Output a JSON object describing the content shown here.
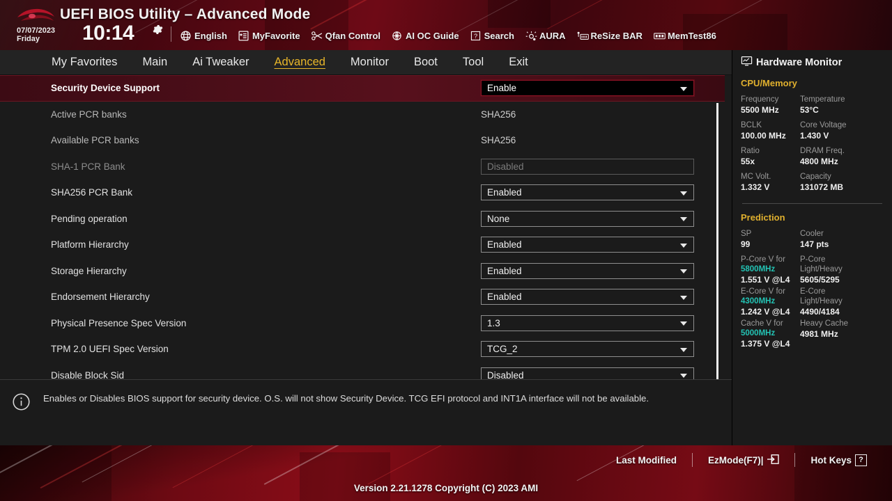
{
  "header": {
    "title": "UEFI BIOS Utility – Advanced Mode",
    "logo_name": "rog-logo",
    "date": "07/07/2023",
    "weekday": "Friday",
    "time": "10:14",
    "gear_icon": "gear-icon",
    "toolbar": [
      {
        "label": "English",
        "icon": "globe-icon"
      },
      {
        "label": "MyFavorite",
        "icon": "star-list-icon"
      },
      {
        "label": "Qfan Control",
        "icon": "fan-icon"
      },
      {
        "label": "AI OC Guide",
        "icon": "ai-brain-icon"
      },
      {
        "label": "Search",
        "icon": "question-box-icon"
      },
      {
        "label": "AURA",
        "icon": "lightbulb-icon"
      },
      {
        "label": "ReSize BAR",
        "icon": "resize-bar-icon"
      },
      {
        "label": "MemTest86",
        "icon": "memory-icon"
      }
    ]
  },
  "menu": {
    "tabs": [
      {
        "label": "My Favorites",
        "active": false
      },
      {
        "label": "Main",
        "active": false
      },
      {
        "label": "Ai Tweaker",
        "active": false
      },
      {
        "label": "Advanced",
        "active": true
      },
      {
        "label": "Monitor",
        "active": false
      },
      {
        "label": "Boot",
        "active": false
      },
      {
        "label": "Tool",
        "active": false
      },
      {
        "label": "Exit",
        "active": false
      }
    ],
    "active_color": "#e8b629"
  },
  "settings": {
    "rows": [
      {
        "name": "Security Device Support",
        "value": "Enable",
        "type": "dropdown",
        "state": "selected"
      },
      {
        "name": "Active PCR banks",
        "value": "SHA256",
        "type": "text",
        "state": "readonly"
      },
      {
        "name": "Available PCR banks",
        "value": "SHA256",
        "type": "text",
        "state": "readonly"
      },
      {
        "name": "SHA-1 PCR Bank",
        "value": "Disabled",
        "type": "dropdown",
        "state": "disabled"
      },
      {
        "name": "SHA256 PCR Bank",
        "value": "Enabled",
        "type": "dropdown",
        "state": "normal"
      },
      {
        "name": "Pending operation",
        "value": "None",
        "type": "dropdown",
        "state": "normal"
      },
      {
        "name": "Platform Hierarchy",
        "value": "Enabled",
        "type": "dropdown",
        "state": "normal"
      },
      {
        "name": "Storage Hierarchy",
        "value": "Enabled",
        "type": "dropdown",
        "state": "normal"
      },
      {
        "name": "Endorsement Hierarchy",
        "value": "Enabled",
        "type": "dropdown",
        "state": "normal"
      },
      {
        "name": "Physical Presence Spec Version",
        "value": "1.3",
        "type": "dropdown",
        "state": "normal"
      },
      {
        "name": "TPM 2.0 UEFI Spec Version",
        "value": "TCG_2",
        "type": "dropdown",
        "state": "normal"
      },
      {
        "name": "Disable Block Sid",
        "value": "Disabled",
        "type": "dropdown",
        "state": "normal"
      }
    ]
  },
  "help": {
    "icon": "info-icon",
    "text": "Enables or Disables BIOS support for security device. O.S. will not show Security Device. TCG EFI protocol and INT1A interface will not be available."
  },
  "hardware_monitor": {
    "title": "Hardware Monitor",
    "title_icon": "monitor-icon",
    "sections": [
      {
        "name": "CPU/Memory",
        "accent": "#e0b02e",
        "pairs": [
          {
            "k1": "Frequency",
            "v1": "5500 MHz",
            "k2": "Temperature",
            "v2": "53°C"
          },
          {
            "k1": "BCLK",
            "v1": "100.00 MHz",
            "k2": "Core Voltage",
            "v2": "1.430 V"
          },
          {
            "k1": "Ratio",
            "v1": "55x",
            "k2": "DRAM Freq.",
            "v2": "4800 MHz"
          },
          {
            "k1": "MC Volt.",
            "v1": "1.332 V",
            "k2": "Capacity",
            "v2": "131072 MB"
          }
        ]
      },
      {
        "name": "Prediction",
        "accent": "#e0b02e",
        "pairs": [
          {
            "k1": "SP",
            "v1": "99",
            "k2": "Cooler",
            "v2": "147 pts"
          }
        ]
      }
    ],
    "prediction_details": [
      {
        "k1a": "P-Core V for",
        "k1b": "5800MHz",
        "v1": "1.551 V @L4",
        "k2a": "P-Core",
        "k2b": "Light/Heavy",
        "v2": "5605/5295"
      },
      {
        "k1a": "E-Core V for",
        "k1b": "4300MHz",
        "v1": "1.242 V @L4",
        "k2a": "E-Core",
        "k2b": "Light/Heavy",
        "v2": "4490/4184"
      },
      {
        "k1a": "Cache V for",
        "k1b": "5000MHz",
        "v1": "1.375 V @L4",
        "k2a": "Heavy Cache",
        "k2b": "",
        "v2": "4981 MHz"
      }
    ],
    "accent_freq_color": "#23c3b4"
  },
  "footer": {
    "items": [
      {
        "label": "Last Modified",
        "icon": ""
      },
      {
        "label": "EzMode(F7)|",
        "icon": "exit-arrow-icon"
      },
      {
        "label": "Hot Keys",
        "icon": "question-box-icon"
      }
    ],
    "version": "Version 2.21.1278 Copyright (C) 2023 AMI"
  }
}
